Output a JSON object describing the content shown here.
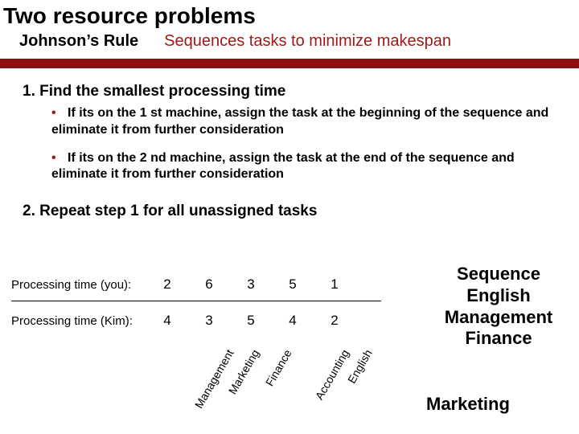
{
  "title": "Two resource problems",
  "rule_name": "Johnson’s Rule",
  "rule_desc": "Sequences tasks to minimize makespan",
  "step1": "1.  Find the smallest processing time",
  "bullet1": "If its on the 1 st machine, assign the task at the beginning of the sequence and eliminate it from further consideration",
  "bullet2": "If its on the 2 nd machine, assign the task at the end of the sequence and eliminate it from further consideration",
  "step2": "2.  Repeat step 1 for all unassigned tasks",
  "rows": [
    {
      "label": "Processing time (you):",
      "values": [
        "2",
        "6",
        "3",
        "5",
        "1"
      ]
    },
    {
      "label": "Processing time (Kim):",
      "values": [
        "4",
        "3",
        "5",
        "4",
        "2"
      ]
    }
  ],
  "columns": [
    "Management",
    "Marketing",
    "Finance",
    "Accounting",
    "English"
  ],
  "sequence_header": "Sequence",
  "sequence": [
    "English",
    "Management",
    "Finance"
  ],
  "footer_note": "Marketing",
  "chart_data": {
    "type": "table",
    "columns": [
      "Management",
      "Marketing",
      "Finance",
      "Accounting",
      "English"
    ],
    "series": [
      {
        "name": "Processing time (you)",
        "values": [
          2,
          6,
          3,
          5,
          1
        ]
      },
      {
        "name": "Processing time (Kim)",
        "values": [
          4,
          3,
          5,
          4,
          2
        ]
      }
    ],
    "title": "Two resource problems — Johnson’s Rule processing times"
  }
}
